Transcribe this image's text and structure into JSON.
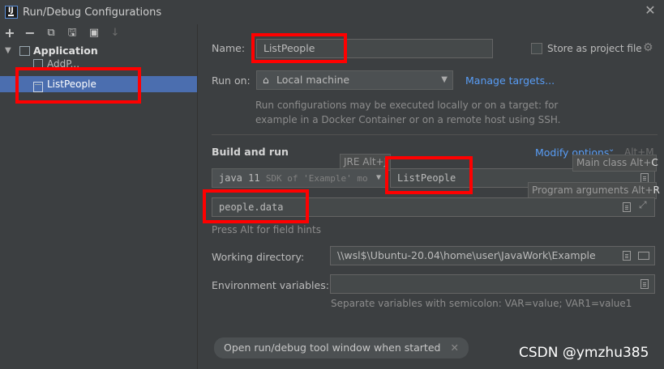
{
  "window": {
    "title": "Run/Debug Configurations",
    "app_icon_letter": "IJ",
    "close_glyph": "✕"
  },
  "toolbar": {
    "add": "+",
    "remove": "−",
    "copy": "⧉",
    "save": "🖫",
    "folder": "▣",
    "sort": "↓"
  },
  "tree": {
    "group_label": "Application",
    "items": [
      {
        "label": "AddP..."
      },
      {
        "label": "ListPeople"
      }
    ]
  },
  "form": {
    "name_label": "Name:",
    "name_value": "ListPeople",
    "store_label": "Store as project file",
    "run_on_label": "Run on:",
    "run_on_value": "Local machine",
    "manage_targets": "Manage targets...",
    "run_on_hint_1": "Run configurations may be executed locally or on a target: for",
    "run_on_hint_2": "example in a Docker Container or on a remote host using SSH.",
    "build_run_label": "Build and run",
    "modify_options": "Modify options",
    "modify_shortcut": "Alt+M",
    "jre_tip": "JRE Alt+J",
    "sdk_value": "java 11",
    "sdk_suffix": "SDK of 'Example' mo",
    "main_class_value": "ListPeople",
    "main_class_tip": "Main class Alt+",
    "main_class_key": "C",
    "program_args_tip": "Program arguments Alt+",
    "program_args_key": "R",
    "program_args_value": "people.data",
    "field_hint": "Press Alt for field hints",
    "workdir_label": "Working directory:",
    "workdir_value": "\\\\wsl$\\Ubuntu-20.04\\home\\user\\JavaWork\\Example",
    "env_label": "Environment variables:",
    "env_value": "",
    "env_hint": "Separate variables with semicolon: VAR=value; VAR1=value1",
    "open_tool_window": "Open run/debug tool window when started"
  },
  "watermark": "CSDN @ymzhu385",
  "colors": {
    "highlight": "#ff0000",
    "selection": "#4b6eaf",
    "link": "#589df6",
    "background": "#3c3f41"
  }
}
